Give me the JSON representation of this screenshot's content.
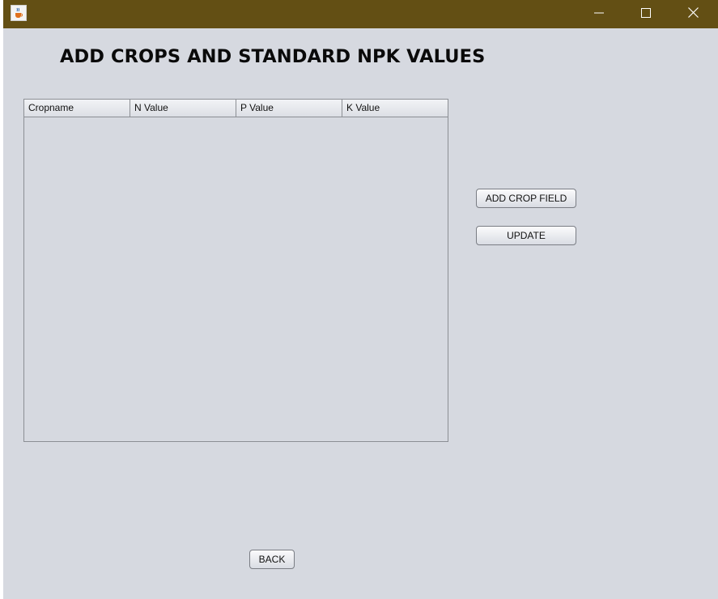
{
  "window": {
    "titlebar_color": "#634f14",
    "background_color": "#d6d9e0",
    "app_icon": "java-coffee-cup-icon",
    "controls": [
      "minimize-icon",
      "maximize-icon",
      "close-icon"
    ]
  },
  "heading": "ADD CROPS AND STANDARD NPK VALUES",
  "table": {
    "columns": [
      "Cropname",
      "N Value",
      "P Value",
      "K Value"
    ],
    "rows": []
  },
  "buttons": {
    "add_crop_field": "ADD CROP FIELD",
    "update": "UPDATE",
    "back": "BACK"
  }
}
